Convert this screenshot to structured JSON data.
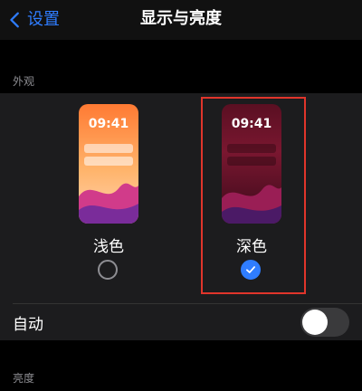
{
  "navbar": {
    "back_label": "设置",
    "title": "显示与亮度"
  },
  "appearance": {
    "section_header": "外观",
    "options": [
      {
        "time": "09:41",
        "label": "浅色",
        "selected": false
      },
      {
        "time": "09:41",
        "label": "深色",
        "selected": true
      }
    ],
    "automatic": {
      "label": "自动",
      "enabled": false
    }
  },
  "brightness": {
    "section_header": "亮度"
  },
  "colors": {
    "accent": "#2f7dff",
    "selection_outline": "#e0352b"
  }
}
